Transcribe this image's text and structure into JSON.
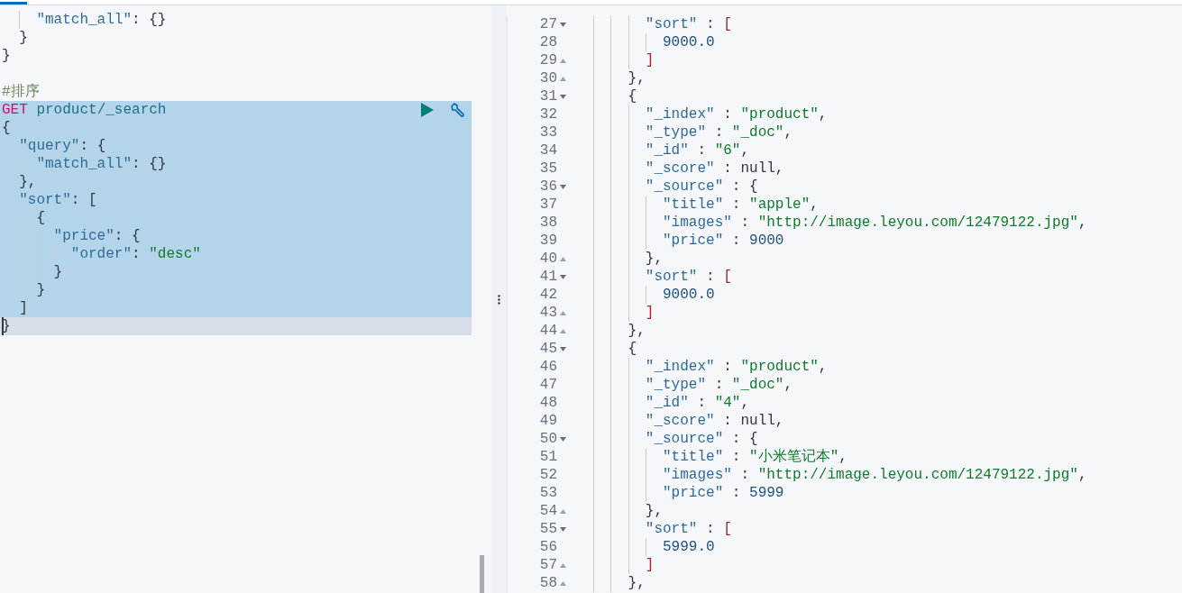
{
  "request_editor": {
    "lines": [
      {
        "kind": "code",
        "selected": false,
        "active": false,
        "tokens": [
          {
            "kind": "key",
            "text": "    \"match_all\""
          },
          {
            "kind": "punct",
            "text": ": {}"
          }
        ]
      },
      {
        "kind": "code",
        "selected": false,
        "active": false,
        "tokens": [
          {
            "kind": "punct",
            "text": "  }"
          }
        ]
      },
      {
        "kind": "code",
        "selected": false,
        "active": false,
        "tokens": [
          {
            "kind": "punct",
            "text": "}"
          }
        ]
      },
      {
        "kind": "code",
        "selected": false,
        "active": false
      },
      {
        "kind": "code",
        "selected": false,
        "active": false,
        "tokens": [
          {
            "kind": "comment",
            "text": "#排序"
          }
        ]
      },
      {
        "kind": "request",
        "selected": true,
        "active": false,
        "tokens": [
          {
            "kind": "method",
            "text": "GET"
          },
          {
            "kind": "path",
            "text": " product/_search"
          }
        ]
      },
      {
        "kind": "code",
        "selected": true,
        "active": false,
        "tokens": [
          {
            "kind": "punct",
            "text": "{"
          }
        ]
      },
      {
        "kind": "code",
        "selected": true,
        "active": false,
        "tokens": [
          {
            "kind": "key",
            "text": "  \"query\""
          },
          {
            "kind": "punct",
            "text": ": {"
          }
        ]
      },
      {
        "kind": "code",
        "selected": true,
        "active": false,
        "tokens": [
          {
            "kind": "key",
            "text": "    \"match_all\""
          },
          {
            "kind": "punct",
            "text": ": {}"
          }
        ]
      },
      {
        "kind": "code",
        "selected": true,
        "active": false,
        "tokens": [
          {
            "kind": "punct",
            "text": "  },"
          }
        ]
      },
      {
        "kind": "code",
        "selected": true,
        "active": false,
        "tokens": [
          {
            "kind": "key",
            "text": "  \"sort\""
          },
          {
            "kind": "punct",
            "text": ": ["
          }
        ]
      },
      {
        "kind": "code",
        "selected": true,
        "active": false,
        "tokens": [
          {
            "kind": "punct",
            "text": "    {"
          }
        ]
      },
      {
        "kind": "code",
        "selected": true,
        "active": false,
        "tokens": [
          {
            "kind": "key",
            "text": "      \"price\""
          },
          {
            "kind": "punct",
            "text": ": {"
          }
        ]
      },
      {
        "kind": "code",
        "selected": true,
        "active": false,
        "tokens": [
          {
            "kind": "key",
            "text": "        \"order\""
          },
          {
            "kind": "punct",
            "text": ": "
          },
          {
            "kind": "string",
            "text": "\"desc\""
          }
        ]
      },
      {
        "kind": "code",
        "selected": true,
        "active": false,
        "tokens": [
          {
            "kind": "punct",
            "text": "      }"
          }
        ]
      },
      {
        "kind": "code",
        "selected": true,
        "active": false,
        "tokens": [
          {
            "kind": "punct",
            "text": "    }"
          }
        ]
      },
      {
        "kind": "code",
        "selected": true,
        "active": false,
        "tokens": [
          {
            "kind": "punct",
            "text": "  ]"
          }
        ]
      },
      {
        "kind": "code",
        "selected": false,
        "active": true,
        "tokens": [
          {
            "kind": "punct",
            "text": "}"
          }
        ]
      }
    ]
  },
  "response_viewer": {
    "lines": [
      {
        "number": "27",
        "kind": "fold-start",
        "tokens": [
          {
            "kind": "key",
            "text": "        \"sort\""
          },
          {
            "kind": "punct",
            "text": " : "
          },
          {
            "kind": "bracket",
            "text": "["
          }
        ]
      },
      {
        "number": "28",
        "kind": "plain",
        "tokens": [
          {
            "kind": "number",
            "text": "          9000.0"
          }
        ]
      },
      {
        "number": "29",
        "kind": "fold-end",
        "tokens": [
          {
            "kind": "bracket",
            "text": "        ]"
          }
        ]
      },
      {
        "number": "30",
        "kind": "fold-end",
        "tokens": [
          {
            "kind": "punct",
            "text": "      },"
          }
        ]
      },
      {
        "number": "31",
        "kind": "fold-start",
        "tokens": [
          {
            "kind": "punct",
            "text": "      {"
          }
        ]
      },
      {
        "number": "32",
        "kind": "plain",
        "tokens": [
          {
            "kind": "key",
            "text": "        \"_index\""
          },
          {
            "kind": "punct",
            "text": " : "
          },
          {
            "kind": "string",
            "text": "\"product\""
          },
          {
            "kind": "punct",
            "text": ","
          }
        ]
      },
      {
        "number": "33",
        "kind": "plain",
        "tokens": [
          {
            "kind": "key",
            "text": "        \"_type\""
          },
          {
            "kind": "punct",
            "text": " : "
          },
          {
            "kind": "string",
            "text": "\"_doc\""
          },
          {
            "kind": "punct",
            "text": ","
          }
        ]
      },
      {
        "number": "34",
        "kind": "plain",
        "tokens": [
          {
            "kind": "key",
            "text": "        \"_id\""
          },
          {
            "kind": "punct",
            "text": " : "
          },
          {
            "kind": "string",
            "text": "\"6\""
          },
          {
            "kind": "punct",
            "text": ","
          }
        ]
      },
      {
        "number": "35",
        "kind": "plain",
        "tokens": [
          {
            "kind": "key",
            "text": "        \"_score\""
          },
          {
            "kind": "punct",
            "text": " : null,"
          }
        ]
      },
      {
        "number": "36",
        "kind": "fold-start",
        "tokens": [
          {
            "kind": "key",
            "text": "        \"_source\""
          },
          {
            "kind": "punct",
            "text": " : {"
          }
        ]
      },
      {
        "number": "37",
        "kind": "plain",
        "tokens": [
          {
            "kind": "key",
            "text": "          \"title\""
          },
          {
            "kind": "punct",
            "text": " : "
          },
          {
            "kind": "string",
            "text": "\"apple\""
          },
          {
            "kind": "punct",
            "text": ","
          }
        ]
      },
      {
        "number": "38",
        "kind": "plain",
        "tokens": [
          {
            "kind": "key",
            "text": "          \"images\""
          },
          {
            "kind": "punct",
            "text": " : "
          },
          {
            "kind": "string",
            "text": "\"http://image.leyou.com/12479122.jpg\""
          },
          {
            "kind": "punct",
            "text": ","
          }
        ]
      },
      {
        "number": "39",
        "kind": "plain",
        "tokens": [
          {
            "kind": "key",
            "text": "          \"price\""
          },
          {
            "kind": "punct",
            "text": " : "
          },
          {
            "kind": "number",
            "text": "9000"
          }
        ]
      },
      {
        "number": "40",
        "kind": "fold-end",
        "tokens": [
          {
            "kind": "punct",
            "text": "        },"
          }
        ]
      },
      {
        "number": "41",
        "kind": "fold-start",
        "tokens": [
          {
            "kind": "key",
            "text": "        \"sort\""
          },
          {
            "kind": "punct",
            "text": " : "
          },
          {
            "kind": "bracket",
            "text": "["
          }
        ]
      },
      {
        "number": "42",
        "kind": "plain",
        "tokens": [
          {
            "kind": "number",
            "text": "          9000.0"
          }
        ]
      },
      {
        "number": "43",
        "kind": "fold-end",
        "tokens": [
          {
            "kind": "bracket",
            "text": "        ]"
          }
        ]
      },
      {
        "number": "44",
        "kind": "fold-end",
        "tokens": [
          {
            "kind": "punct",
            "text": "      },"
          }
        ]
      },
      {
        "number": "45",
        "kind": "fold-start",
        "tokens": [
          {
            "kind": "punct",
            "text": "      {"
          }
        ]
      },
      {
        "number": "46",
        "kind": "plain",
        "tokens": [
          {
            "kind": "key",
            "text": "        \"_index\""
          },
          {
            "kind": "punct",
            "text": " : "
          },
          {
            "kind": "string",
            "text": "\"product\""
          },
          {
            "kind": "punct",
            "text": ","
          }
        ]
      },
      {
        "number": "47",
        "kind": "plain",
        "tokens": [
          {
            "kind": "key",
            "text": "        \"_type\""
          },
          {
            "kind": "punct",
            "text": " : "
          },
          {
            "kind": "string",
            "text": "\"_doc\""
          },
          {
            "kind": "punct",
            "text": ","
          }
        ]
      },
      {
        "number": "48",
        "kind": "plain",
        "tokens": [
          {
            "kind": "key",
            "text": "        \"_id\""
          },
          {
            "kind": "punct",
            "text": " : "
          },
          {
            "kind": "string",
            "text": "\"4\""
          },
          {
            "kind": "punct",
            "text": ","
          }
        ]
      },
      {
        "number": "49",
        "kind": "plain",
        "tokens": [
          {
            "kind": "key",
            "text": "        \"_score\""
          },
          {
            "kind": "punct",
            "text": " : null,"
          }
        ]
      },
      {
        "number": "50",
        "kind": "fold-start",
        "tokens": [
          {
            "kind": "key",
            "text": "        \"_source\""
          },
          {
            "kind": "punct",
            "text": " : {"
          }
        ]
      },
      {
        "number": "51",
        "kind": "plain",
        "tokens": [
          {
            "kind": "key",
            "text": "          \"title\""
          },
          {
            "kind": "punct",
            "text": " : "
          },
          {
            "kind": "string",
            "text": "\"小米笔记本\""
          },
          {
            "kind": "punct",
            "text": ","
          }
        ]
      },
      {
        "number": "52",
        "kind": "plain",
        "tokens": [
          {
            "kind": "key",
            "text": "          \"images\""
          },
          {
            "kind": "punct",
            "text": " : "
          },
          {
            "kind": "string",
            "text": "\"http://image.leyou.com/12479122.jpg\""
          },
          {
            "kind": "punct",
            "text": ","
          }
        ]
      },
      {
        "number": "53",
        "kind": "plain",
        "tokens": [
          {
            "kind": "key",
            "text": "          \"price\""
          },
          {
            "kind": "punct",
            "text": " : "
          },
          {
            "kind": "number",
            "text": "5999"
          }
        ]
      },
      {
        "number": "54",
        "kind": "fold-end",
        "tokens": [
          {
            "kind": "punct",
            "text": "        },"
          }
        ]
      },
      {
        "number": "55",
        "kind": "fold-start",
        "tokens": [
          {
            "kind": "key",
            "text": "        \"sort\""
          },
          {
            "kind": "punct",
            "text": " : "
          },
          {
            "kind": "bracket",
            "text": "["
          }
        ]
      },
      {
        "number": "56",
        "kind": "plain",
        "tokens": [
          {
            "kind": "number",
            "text": "          5999.0"
          }
        ]
      },
      {
        "number": "57",
        "kind": "fold-end",
        "tokens": [
          {
            "kind": "bracket",
            "text": "        ]"
          }
        ]
      },
      {
        "number": "58",
        "kind": "fold-end",
        "tokens": [
          {
            "kind": "punct",
            "text": "      },"
          }
        ]
      }
    ]
  }
}
